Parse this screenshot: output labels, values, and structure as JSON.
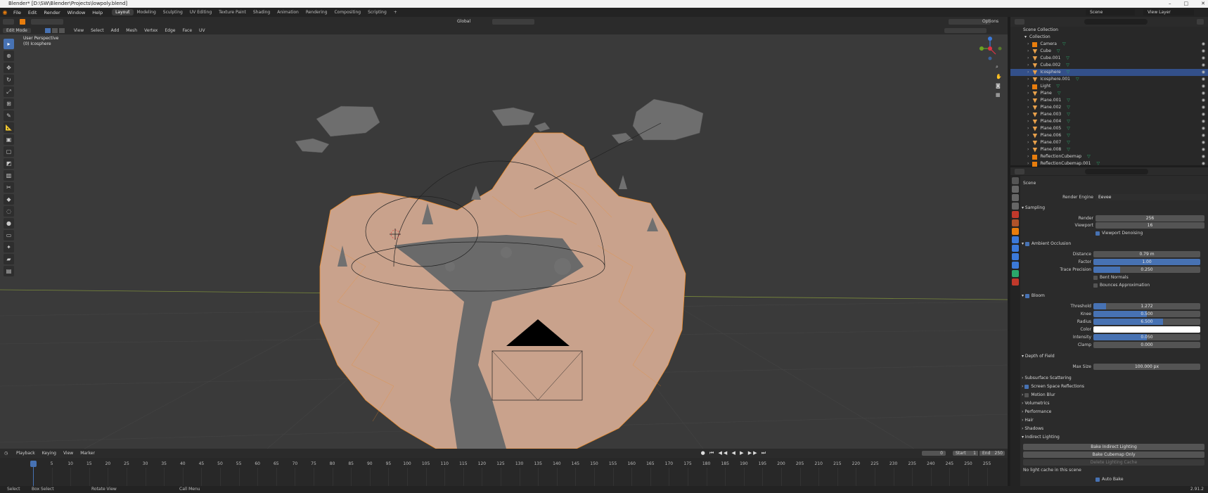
{
  "window": {
    "title": "Blender* [D:\\SW\\Blender\\Projects\\lowpoly.blend]"
  },
  "menubar": {
    "menus": [
      "File",
      "Edit",
      "Render",
      "Window",
      "Help"
    ],
    "workspaces": [
      "Layout",
      "Modeling",
      "Sculpting",
      "UV Editing",
      "Texture Paint",
      "Shading",
      "Animation",
      "Rendering",
      "Compositing",
      "Scripting"
    ],
    "active_workspace": "Layout",
    "scene": "Scene",
    "view_layer": "View Layer"
  },
  "viewport_header": {
    "mode": "Edit Mode",
    "menus": [
      "View",
      "Select",
      "Add",
      "Mesh",
      "Vertex",
      "Edge",
      "Face",
      "UV"
    ],
    "orientation": "Global",
    "options": "Options"
  },
  "viewport": {
    "perspective": "User Perspective",
    "object": "(0) Icosphere"
  },
  "timeline": {
    "menus": [
      "Playback",
      "Keying",
      "View",
      "Marker"
    ],
    "current_frame": "0",
    "start_label": "Start",
    "start": "1",
    "end_label": "End",
    "end": "250",
    "ticks": [
      "0",
      "5",
      "10",
      "15",
      "20",
      "25",
      "30",
      "35",
      "40",
      "45",
      "50",
      "55",
      "60",
      "65",
      "70",
      "75",
      "80",
      "85",
      "90",
      "95",
      "100",
      "105",
      "110",
      "115",
      "120",
      "125",
      "130",
      "135",
      "140",
      "145",
      "150",
      "155",
      "160",
      "165",
      "170",
      "175",
      "180",
      "185",
      "190",
      "195",
      "200",
      "205",
      "210",
      "215",
      "220",
      "225",
      "230",
      "235",
      "240",
      "245",
      "250",
      "255"
    ]
  },
  "statusbar": {
    "items": [
      "Select",
      "Box Select",
      "Rotate View",
      "Call Menu"
    ],
    "version": "2.91.2"
  },
  "outliner": {
    "root": "Scene Collection",
    "collection": "Collection",
    "items": [
      {
        "name": "Camera",
        "type": "camera"
      },
      {
        "name": "Cube",
        "type": "mesh"
      },
      {
        "name": "Cube.001",
        "type": "mesh"
      },
      {
        "name": "Cube.002",
        "type": "mesh"
      },
      {
        "name": "Icosphere",
        "type": "mesh",
        "selected": true
      },
      {
        "name": "Icosphere.001",
        "type": "mesh"
      },
      {
        "name": "Light",
        "type": "light"
      },
      {
        "name": "Plane",
        "type": "mesh"
      },
      {
        "name": "Plane.001",
        "type": "mesh"
      },
      {
        "name": "Plane.002",
        "type": "mesh"
      },
      {
        "name": "Plane.003",
        "type": "mesh"
      },
      {
        "name": "Plane.004",
        "type": "mesh"
      },
      {
        "name": "Plane.005",
        "type": "mesh"
      },
      {
        "name": "Plane.006",
        "type": "mesh"
      },
      {
        "name": "Plane.007",
        "type": "mesh"
      },
      {
        "name": "Plane.008",
        "type": "mesh"
      },
      {
        "name": "ReflectionCubemap",
        "type": "probe"
      },
      {
        "name": "ReflectionCubemap.001",
        "type": "probe"
      }
    ]
  },
  "properties": {
    "context": "Scene",
    "render_engine_label": "Render Engine",
    "render_engine": "Eevee",
    "sampling": {
      "title": "Sampling",
      "render_label": "Render",
      "render": "256",
      "viewport_label": "Viewport",
      "viewport": "16",
      "denoise": "Viewport Denoising"
    },
    "ao": {
      "title": "Ambient Occlusion",
      "distance_label": "Distance",
      "distance": "0.79 m",
      "factor_label": "Factor",
      "factor": "1.00",
      "trace_label": "Trace Precision",
      "trace": "0.250",
      "trace_fill": 0.25,
      "bent": "Bent Normals",
      "bounces": "Bounces Approximation"
    },
    "bloom": {
      "title": "Bloom",
      "threshold_label": "Threshold",
      "threshold": "1.272",
      "threshold_fill": 0.12,
      "knee_label": "Knee",
      "knee": "0.500",
      "knee_fill": 0.5,
      "radius_label": "Radius",
      "radius": "6.500",
      "radius_fill": 0.65,
      "color_label": "Color",
      "intensity_label": "Intensity",
      "intensity": "0.050",
      "intensity_fill": 0.5,
      "clamp_label": "Clamp",
      "clamp": "0.000"
    },
    "dof": {
      "title": "Depth of Field",
      "max_label": "Max Size",
      "max": "100.000 px"
    },
    "sections": [
      "Subsurface Scattering",
      "Screen Space Reflections",
      "Motion Blur",
      "Volumetrics",
      "Performance",
      "Hair",
      "Shadows",
      "Indirect Lighting"
    ],
    "bake_indirect": "Bake Indirect Lighting",
    "bake_cubemap": "Bake Cubemap Only",
    "delete_cache": "Delete Lighting Cache",
    "no_cache": "No light cache in this scene",
    "auto_bake": "Auto Bake"
  },
  "colors": {
    "accent": "#4772b3",
    "selection": "#f08a23",
    "mesh": "#caa48d",
    "bg": "#3a3a3a"
  }
}
